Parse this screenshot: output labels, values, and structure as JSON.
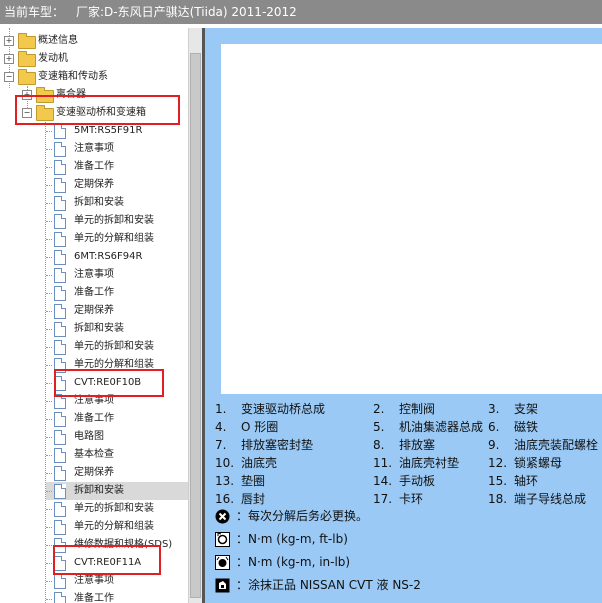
{
  "titlebar": {
    "prefix": "当前车型：",
    "vehicle": "厂家:D-东风日产骐达(Tiida) 2011-2012"
  },
  "tree": {
    "items": [
      {
        "label": "概述信息",
        "type": "folder",
        "expander": "+"
      },
      {
        "label": "发动机",
        "type": "folder",
        "expander": "+"
      },
      {
        "label": "变速箱和传动系",
        "type": "folder",
        "expander": "-"
      },
      {
        "label": "离合器",
        "type": "folder",
        "expander": "+"
      },
      {
        "label": "变速驱动桥和变速箱",
        "type": "folder",
        "expander": "-"
      },
      {
        "label": "5MT:RS5F91R",
        "type": "doc"
      },
      {
        "label": "注意事项",
        "type": "doc"
      },
      {
        "label": "准备工作",
        "type": "doc"
      },
      {
        "label": "定期保养",
        "type": "doc"
      },
      {
        "label": "拆卸和安装",
        "type": "doc"
      },
      {
        "label": "单元的拆卸和安装",
        "type": "doc"
      },
      {
        "label": "单元的分解和组装",
        "type": "doc"
      },
      {
        "label": "6MT:RS6F94R",
        "type": "doc"
      },
      {
        "label": "注意事项",
        "type": "doc"
      },
      {
        "label": "准备工作",
        "type": "doc"
      },
      {
        "label": "定期保养",
        "type": "doc"
      },
      {
        "label": "拆卸和安装",
        "type": "doc"
      },
      {
        "label": "单元的拆卸和安装",
        "type": "doc"
      },
      {
        "label": "单元的分解和组装",
        "type": "doc"
      },
      {
        "label": "CVT:RE0F10B",
        "type": "doc"
      },
      {
        "label": "注意事项",
        "type": "doc"
      },
      {
        "label": "准备工作",
        "type": "doc"
      },
      {
        "label": "电路图",
        "type": "doc"
      },
      {
        "label": "基本检查",
        "type": "doc"
      },
      {
        "label": "定期保养",
        "type": "doc"
      },
      {
        "label": "拆卸和安装",
        "type": "doc",
        "selected": true
      },
      {
        "label": "单元的拆卸和安装",
        "type": "doc"
      },
      {
        "label": "单元的分解和组装",
        "type": "doc"
      },
      {
        "label": "维修数据和规格(SDS)",
        "type": "doc"
      },
      {
        "label": "CVT:RE0F11A",
        "type": "doc"
      },
      {
        "label": "注意事项",
        "type": "doc"
      },
      {
        "label": "准备工作",
        "type": "doc"
      }
    ]
  },
  "legend": [
    {
      "num": "1.",
      "text": "变速驱动桥总成"
    },
    {
      "num": "2.",
      "text": "控制阀"
    },
    {
      "num": "3.",
      "text": "支架"
    },
    {
      "num": "4.",
      "text": "O 形圈"
    },
    {
      "num": "5.",
      "text": "机油集滤器总成"
    },
    {
      "num": "6.",
      "text": "磁铁"
    },
    {
      "num": "7.",
      "text": "排放塞密封垫"
    },
    {
      "num": "8.",
      "text": "排放塞"
    },
    {
      "num": "9.",
      "text": "油底壳装配螺栓"
    },
    {
      "num": "10.",
      "text": "油底壳"
    },
    {
      "num": "11.",
      "text": "油底壳衬垫"
    },
    {
      "num": "12.",
      "text": "锁紧螺母"
    },
    {
      "num": "13.",
      "text": "垫圈"
    },
    {
      "num": "14.",
      "text": "手动板"
    },
    {
      "num": "15.",
      "text": "轴环"
    },
    {
      "num": "16.",
      "text": "唇封"
    },
    {
      "num": "17.",
      "text": "卡环"
    },
    {
      "num": "18.",
      "text": "端子导线总成"
    }
  ],
  "notes": [
    {
      "icon": "replace-icon",
      "text": "：每次分解后务必更换。"
    },
    {
      "icon": "torque-ftlb-icon",
      "text": "：N·m (kg-m, ft-lb)"
    },
    {
      "icon": "torque-inlb-icon",
      "text": "：N·m (kg-m, in-lb)"
    },
    {
      "icon": "apply-fluid-icon",
      "text": "：涂抹正品 NISSAN CVT 液 NS-2"
    }
  ],
  "colors": {
    "content_bg": "#9ac9f5",
    "highlight": "#e02020",
    "titlebar_bg": "#8a8a8a"
  }
}
